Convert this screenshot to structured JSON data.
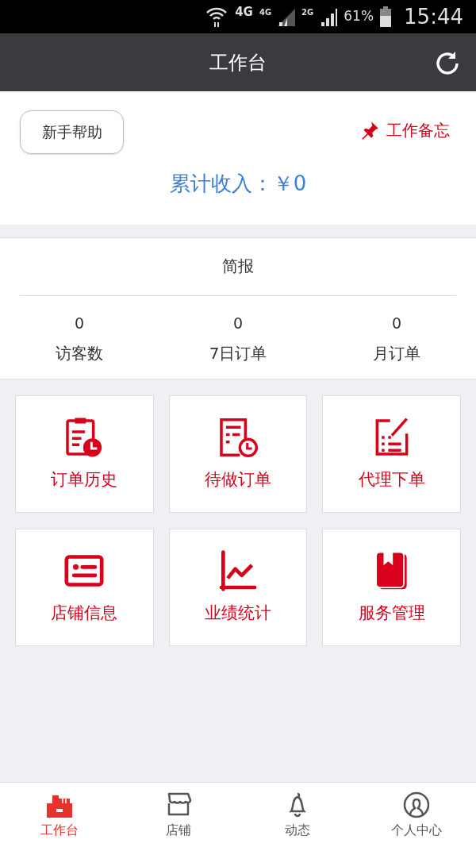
{
  "status_bar": {
    "network": "4G",
    "sim1": "4G",
    "sim2": "2G",
    "battery": "61%",
    "time": "15:44"
  },
  "header": {
    "title": "工作台"
  },
  "top": {
    "help_button": "新手帮助",
    "memo_link": "工作备忘",
    "income": "累计收入：￥0"
  },
  "brief": {
    "title": "简报",
    "stats": [
      {
        "value": "0",
        "label": "访客数"
      },
      {
        "value": "0",
        "label": "7日订单"
      },
      {
        "value": "0",
        "label": "月订单"
      }
    ]
  },
  "tiles": [
    {
      "kind": "history",
      "label": "订单历史"
    },
    {
      "kind": "pending",
      "label": "待做订单"
    },
    {
      "kind": "agent",
      "label": "代理下单"
    },
    {
      "kind": "store",
      "label": "店铺信息"
    },
    {
      "kind": "stats",
      "label": "业绩统计"
    },
    {
      "kind": "service",
      "label": "服务管理"
    }
  ],
  "tabs": [
    {
      "kind": "desk",
      "label": "工作台",
      "selected": true
    },
    {
      "kind": "shop",
      "label": "店铺",
      "selected": false
    },
    {
      "kind": "bell",
      "label": "动态",
      "selected": false
    },
    {
      "kind": "user",
      "label": "个人中心",
      "selected": false
    }
  ]
}
